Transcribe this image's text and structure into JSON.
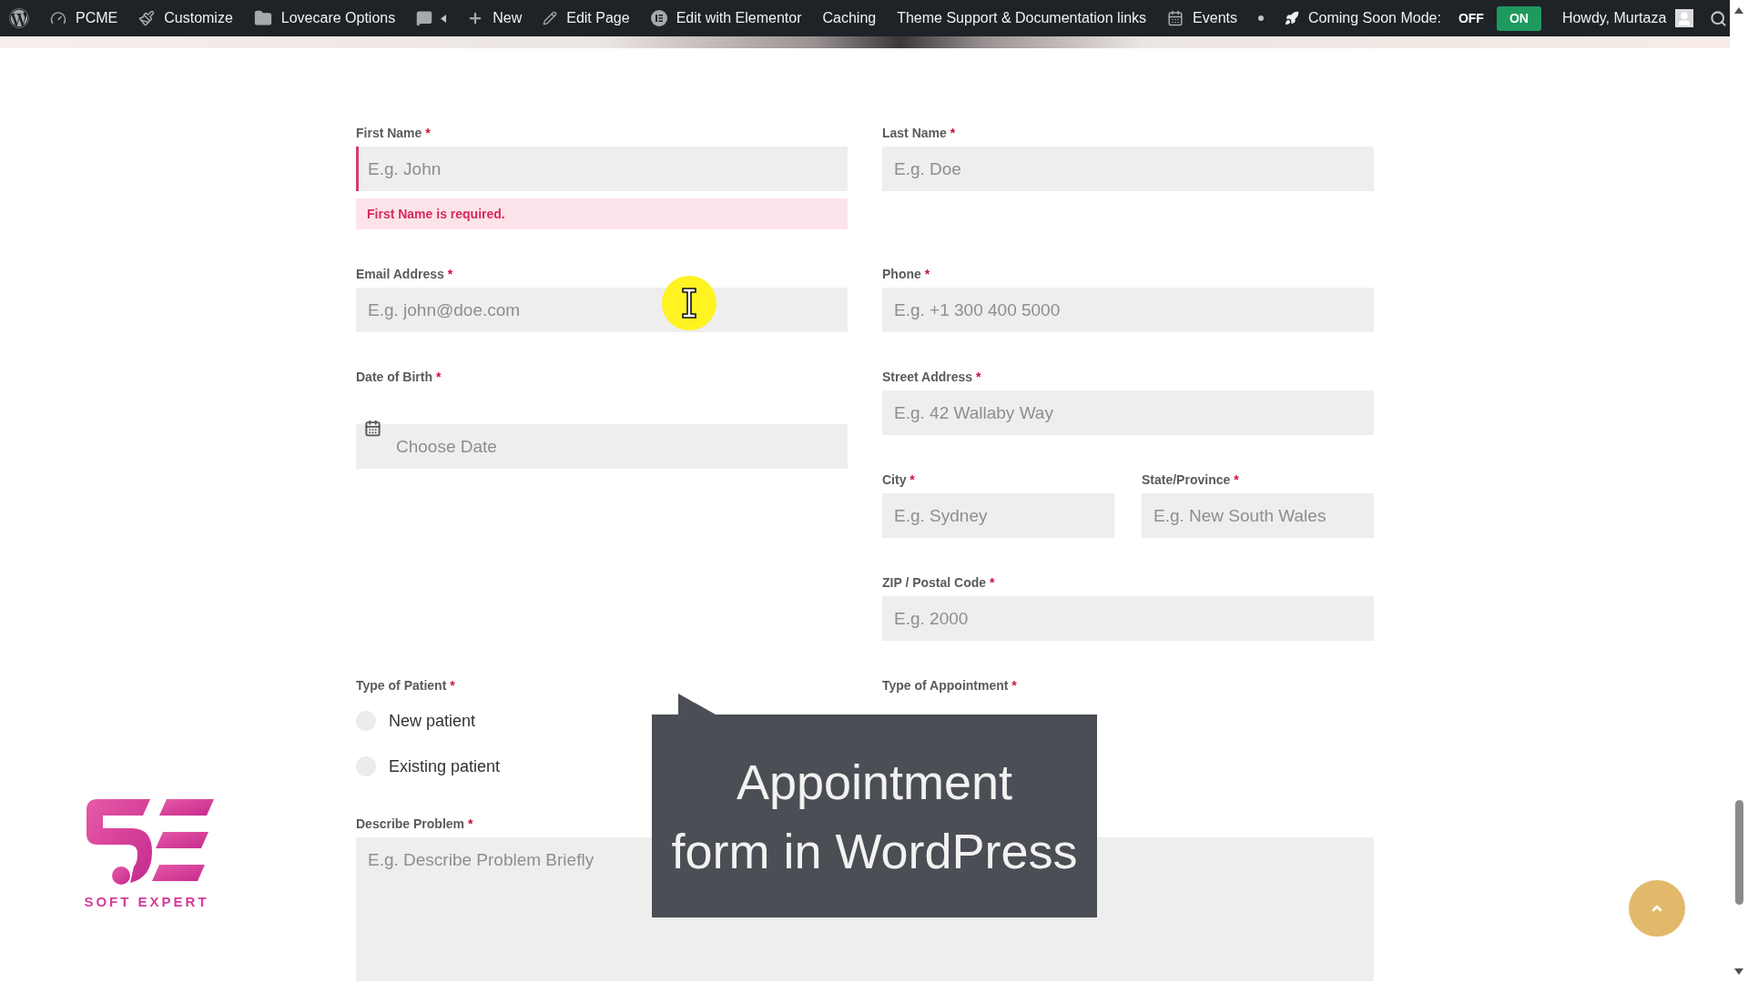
{
  "admin_bar": {
    "items": [
      {
        "kind": "menu",
        "label": "PCME"
      },
      {
        "kind": "menu",
        "label": "Customize"
      },
      {
        "kind": "menu",
        "label": "Lovecare Options"
      },
      {
        "kind": "comments"
      },
      {
        "kind": "menu",
        "label": "New"
      },
      {
        "kind": "menu",
        "label": "Edit Page"
      },
      {
        "kind": "menu",
        "label": "Edit with Elementor"
      },
      {
        "kind": "menu",
        "label": "Caching"
      },
      {
        "kind": "menu",
        "label": "Theme Support & Documentation links"
      },
      {
        "kind": "menu",
        "label": "Events"
      }
    ],
    "coming_soon": {
      "label": "Coming Soon Mode:",
      "options": [
        {
          "label": "OFF",
          "selected": false
        },
        {
          "label": "ON",
          "selected": true
        }
      ]
    },
    "account": {
      "greeting": "Howdy, Murtaza"
    }
  },
  "form": {
    "name_row": [
      {
        "label": "First Name",
        "mark": "*",
        "placeholder": "E.g. John",
        "invalid": true,
        "error": "First Name is required."
      },
      {
        "label": "Last Name",
        "mark": "*",
        "placeholder": "E.g. Doe",
        "invalid": false
      }
    ],
    "contact_row": [
      {
        "label": "Email Address",
        "mark": "*",
        "placeholder": "E.g. john@doe.com",
        "invalid": false
      },
      {
        "label": "Phone",
        "mark": "*",
        "placeholder": "E.g. +1 300 400 5000",
        "invalid": false
      }
    ],
    "date_of_birth": {
      "label": "Date of Birth",
      "mark": "*",
      "placeholder": "Choose Date",
      "invalid": false
    },
    "street": {
      "label": "Street Address",
      "mark": "*",
      "placeholder": "E.g. 42 Wallaby Way",
      "invalid": false
    },
    "city": {
      "label": "City",
      "mark": "*",
      "placeholder": "E.g. Sydney",
      "invalid": false
    },
    "state": {
      "label": "State/Province",
      "mark": "*",
      "placeholder": "E.g. New South Wales",
      "invalid": false
    },
    "zip": {
      "label": "ZIP / Postal Code",
      "mark": "*",
      "placeholder": "E.g. 2000",
      "invalid": false
    },
    "type_of_patient": {
      "label": "Type of Patient",
      "mark": "*",
      "options": [
        {
          "label": "New patient",
          "selected": false
        },
        {
          "label": "Existing patient",
          "selected": false
        }
      ]
    },
    "type_of_appointment": {
      "label": "Type of Appointment",
      "mark": "*"
    },
    "problem": {
      "label": "Describe Problem",
      "mark": "*",
      "placeholder": "E.g. Describe Problem Briefly",
      "invalid": false
    }
  },
  "video_caption": {
    "lines": [
      "Appointment",
      "form in WordPress"
    ]
  },
  "channel_logo": {
    "text": "SOFT EXPERT"
  }
}
